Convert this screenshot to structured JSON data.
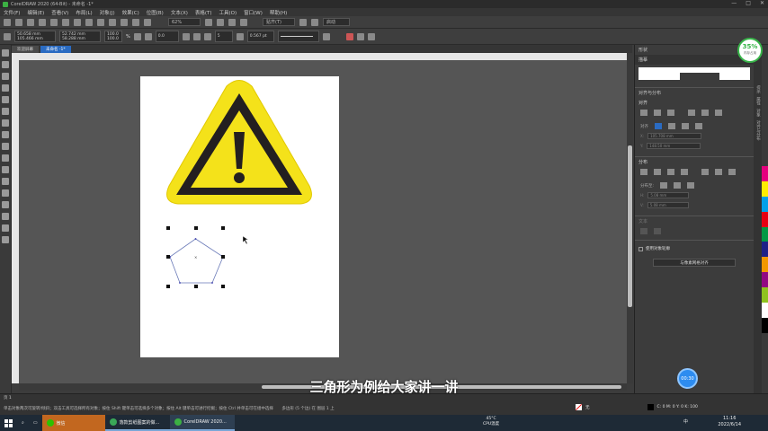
{
  "window": {
    "title": "CorelDRAW 2020 (64-Bit) - 未命名 -1*",
    "min": "—",
    "max": "□",
    "close": "✕"
  },
  "menu": [
    "文件(F)",
    "编辑(E)",
    "查看(V)",
    "布局(L)",
    "对象(J)",
    "效果(C)",
    "位图(B)",
    "文本(X)",
    "表格(T)",
    "工具(O)",
    "窗口(W)",
    "帮助(H)"
  ],
  "toolbar1": {
    "zoom": "62%",
    "snap": "贴齐(T)",
    "launch": "启动"
  },
  "toolbar2": {
    "x": "50.658 mm",
    "y": "105.466 mm",
    "w": "52.742 mm",
    "h": "58.288 mm",
    "sx": "100.0",
    "sy": "100.0",
    "pct": "%",
    "angle": "0.0",
    "sides": "5",
    "outline": "0.567 pt"
  },
  "tabs": {
    "home": "欢迎屏幕",
    "doc": "未命名 -1*"
  },
  "docker": {
    "title": "形状",
    "subtitle": "描摹",
    "align_panel": "对齐与分布",
    "align": "对齐",
    "align_to": "对齐",
    "x_label": "X:",
    "y_label": "Y:",
    "x_val": "105.708 mm",
    "y_val": "148.50 mm",
    "distribute": "分布",
    "dist_to": "分布至:",
    "h_label": "H:",
    "v_label": "V:",
    "h_val": "5.08 mm",
    "v_val": "5.08 mm",
    "text": "文本",
    "use_outline": "使用对象轮廓",
    "pixel_align": "与像素网格对齐"
  },
  "docker_tabs": [
    "提示",
    "属性",
    "对象",
    "对齐与分布"
  ],
  "badge": {
    "pct": "35%",
    "sub": "内存占用"
  },
  "blue_circle": "00:30",
  "status": {
    "hint": "单击对象两次可旋转/倾斜；双击工具可选择所有对象；按住 Shift 键单击可选择多个对象；按住 Alt 键单击可进行挖掘；按住 Ctrl 并单击可在组中选择",
    "object_info": "多边形 (5 个边) 在 图层 1 上",
    "page_nav": "页 1",
    "fill_none": "无",
    "color_info": "C: 0  M: 0  Y: 0  K: 100"
  },
  "subtitle": "三角形为例给大家讲一讲",
  "taskbar": {
    "apps": [
      {
        "label": "微信",
        "color": "#2dc100"
      },
      {
        "label": "落款剪纸图案的做...",
        "color": "#3aa757"
      },
      {
        "label": "CorelDRAW 2020...",
        "color": "#3cb043"
      }
    ],
    "weather_temp": "45°C",
    "weather_label": "CPU温度",
    "lang": "中",
    "time": "11:16",
    "date": "2022/6/14"
  },
  "colors": {
    "warning_yellow": "#f4e21a",
    "warning_black": "#231f20",
    "selection_blue": "#2a6bc2"
  }
}
